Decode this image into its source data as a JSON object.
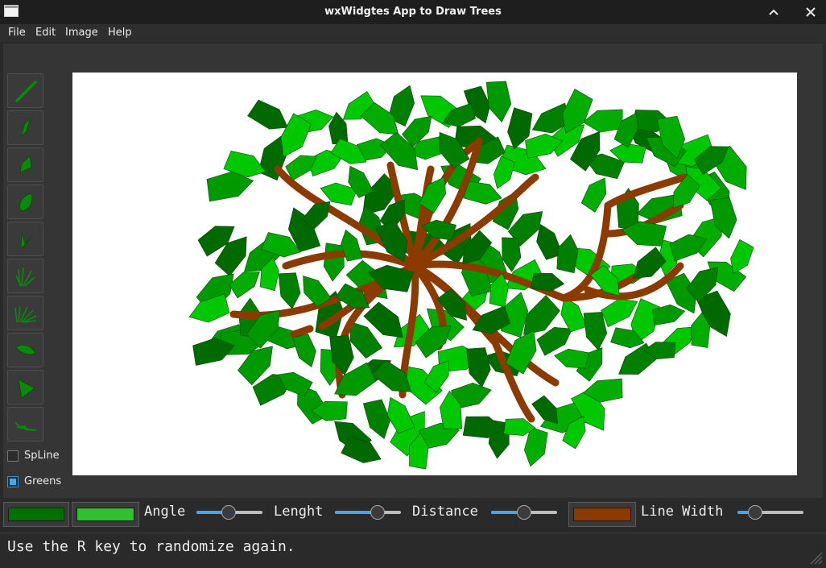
{
  "window": {
    "title": "wxWidgtes App to Draw Trees"
  },
  "menu": [
    "File",
    "Edit",
    "Image",
    "Help"
  ],
  "tools": [
    "line-tool",
    "narrow-leaf-tool",
    "wide-leaf-tool",
    "round-leaf-tool",
    "split-leaf-tool",
    "grass-tool",
    "fern-tool",
    "oval-leaf-tool",
    "triangle-leaf-tool",
    "swoosh-leaf-tool"
  ],
  "options": {
    "spline": {
      "label": "SpLine",
      "checked": false
    },
    "greens": {
      "label": "Greens",
      "checked": true
    }
  },
  "controls": {
    "leaf_color_dark": "#007000",
    "leaf_color_light": "#30c030",
    "branch_color": "#8b3a00",
    "angle": {
      "label": "Angle",
      "value": 0.48
    },
    "length": {
      "label": "Lenght",
      "value": 0.68
    },
    "distance": {
      "label": "Distance",
      "value": 0.5
    },
    "line_width": {
      "label": "Line Width",
      "value": 0.2
    }
  },
  "status": "Use the R key to randomize again.",
  "colors": {
    "branch": "#8b3a00",
    "leaf_dark": "#006a00",
    "leaf_mid": "#009a00",
    "leaf_light": "#00c800"
  }
}
